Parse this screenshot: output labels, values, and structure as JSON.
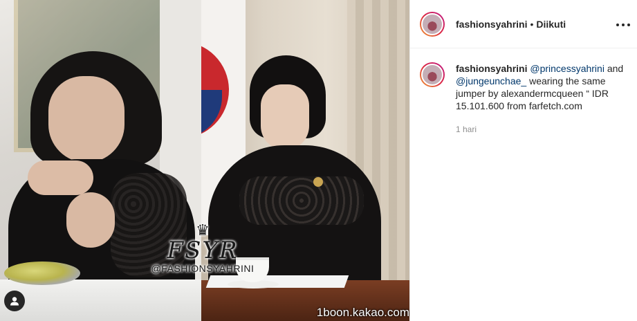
{
  "media": {
    "watermark_monogram": "FSYR",
    "watermark_handle": "@FASHIONSYAHRINI",
    "source_text": "1boon.kakao.com"
  },
  "header": {
    "username": "fashionsyahrini",
    "separator": "•",
    "follow_status": "Diikuti",
    "more_icon": "more-horizontal-icon"
  },
  "caption": {
    "username": "fashionsyahrini",
    "mention_1": "@princessyahrini",
    "and_text": "and",
    "mention_2": "@jungeunchae_",
    "text": "wearing the same jumper by alexandermcqueen “ IDR 15.101.600 from farfetch.com",
    "time": "1 hari"
  },
  "colors": {
    "mention": "#00376b",
    "muted": "#8e8e8e",
    "text": "#262626"
  }
}
